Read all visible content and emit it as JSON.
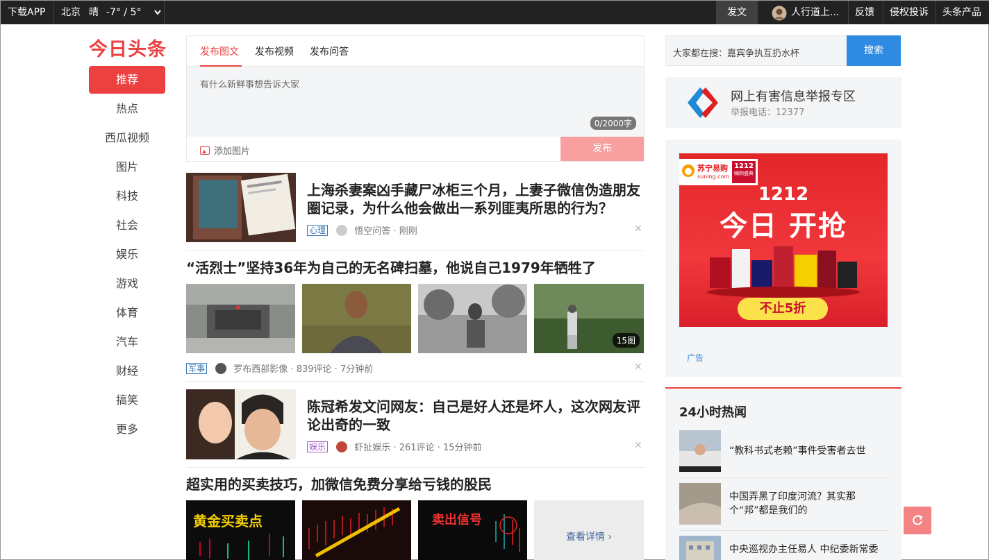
{
  "topbar": {
    "download": "下载APP",
    "city": "北京",
    "weather": "晴",
    "temp": "-7° / 5°",
    "publish": "发文",
    "username": "人行道上...",
    "feedback": "反馈",
    "complaint": "侵权投诉",
    "products": "头条产品"
  },
  "logo": "今日头条",
  "nav": [
    "推荐",
    "热点",
    "西瓜视频",
    "图片",
    "科技",
    "社会",
    "娱乐",
    "游戏",
    "体育",
    "汽车",
    "财经",
    "搞笑",
    "更多"
  ],
  "publish_box": {
    "tabs": [
      "发布图文",
      "发布视频",
      "发布问答"
    ],
    "placeholder": "有什么新鲜事想告诉大家",
    "counter": "0/2000字",
    "add_image": "添加图片",
    "submit": "发布"
  },
  "feed": [
    {
      "title": "上海杀妻案凶手藏尸冰柜三个月，上妻子微信伪造朋友圈记录，为什么他会做出一系列匪夷所思的行为？",
      "tag": "心理",
      "source": "悟空问答",
      "time": "刚刚"
    },
    {
      "title": "“活烈士”坚持36年为自己的无名碑扫墓，他说自己1979年牺牲了",
      "tag": "军事",
      "source": "罗布西部影像",
      "comments": "839评论",
      "time": "7分钟前",
      "image_count": "15图"
    },
    {
      "title": "陈冠希发文问网友：自己是好人还是坏人，这次网友评论出奇的一致",
      "tag": "娱乐",
      "source": "虾扯娱乐",
      "comments": "261评论",
      "time": "15分钟前"
    },
    {
      "title": "超实用的买卖技巧，加微信免费分享给亏钱的股民",
      "thumb_texts": [
        "黄金买卖点",
        "卖出信号"
      ],
      "view_more": "查看详情"
    }
  ],
  "search": {
    "placeholder": "大家都在搜：嘉宾争执互扔水杯",
    "button": "搜索"
  },
  "report": {
    "title": "网上有害信息举报专区",
    "phone": "举报电话：12377"
  },
  "ad": {
    "brand": "苏宁易购",
    "brand_sub": "suning.com",
    "event": "1212",
    "event_sub": "嗨购盛典",
    "headline_num": "1212",
    "headline": "今日 开抢",
    "discount": "不止5折",
    "label": "广告"
  },
  "hot": {
    "title": "24小时热闻",
    "items": [
      "“教科书式老赖”事件受害者去世",
      "中国弄黑了印度河流？其实那个“邦”都是我们的",
      "中央巡视办主任易人 中纪委新常委"
    ]
  },
  "colors": {
    "brand_red": "#ed4040",
    "search_blue": "#2f8be2",
    "topbar": "#222222"
  }
}
